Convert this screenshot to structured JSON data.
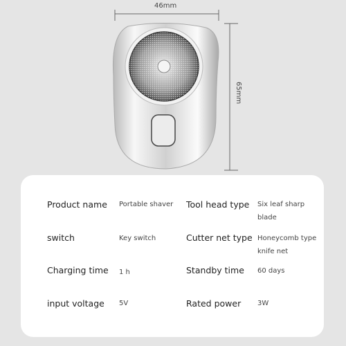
{
  "dimensions": {
    "width": "46mm",
    "height": "65mm"
  },
  "specs": {
    "left": [
      {
        "label": "Product name",
        "value": "Portable shaver"
      },
      {
        "label": "switch",
        "value": "Key switch"
      },
      {
        "label": "Charging time",
        "value": "1 h"
      },
      {
        "label": "input voltage",
        "value": "5V"
      }
    ],
    "right": [
      {
        "label": "Tool head type",
        "value": "Six leaf sharp blade"
      },
      {
        "label": "Cutter net type",
        "value": "Honeycomb type knife net"
      },
      {
        "label": "Standby time",
        "value": "60 days"
      },
      {
        "label": "Rated power",
        "value": "3W"
      }
    ]
  }
}
